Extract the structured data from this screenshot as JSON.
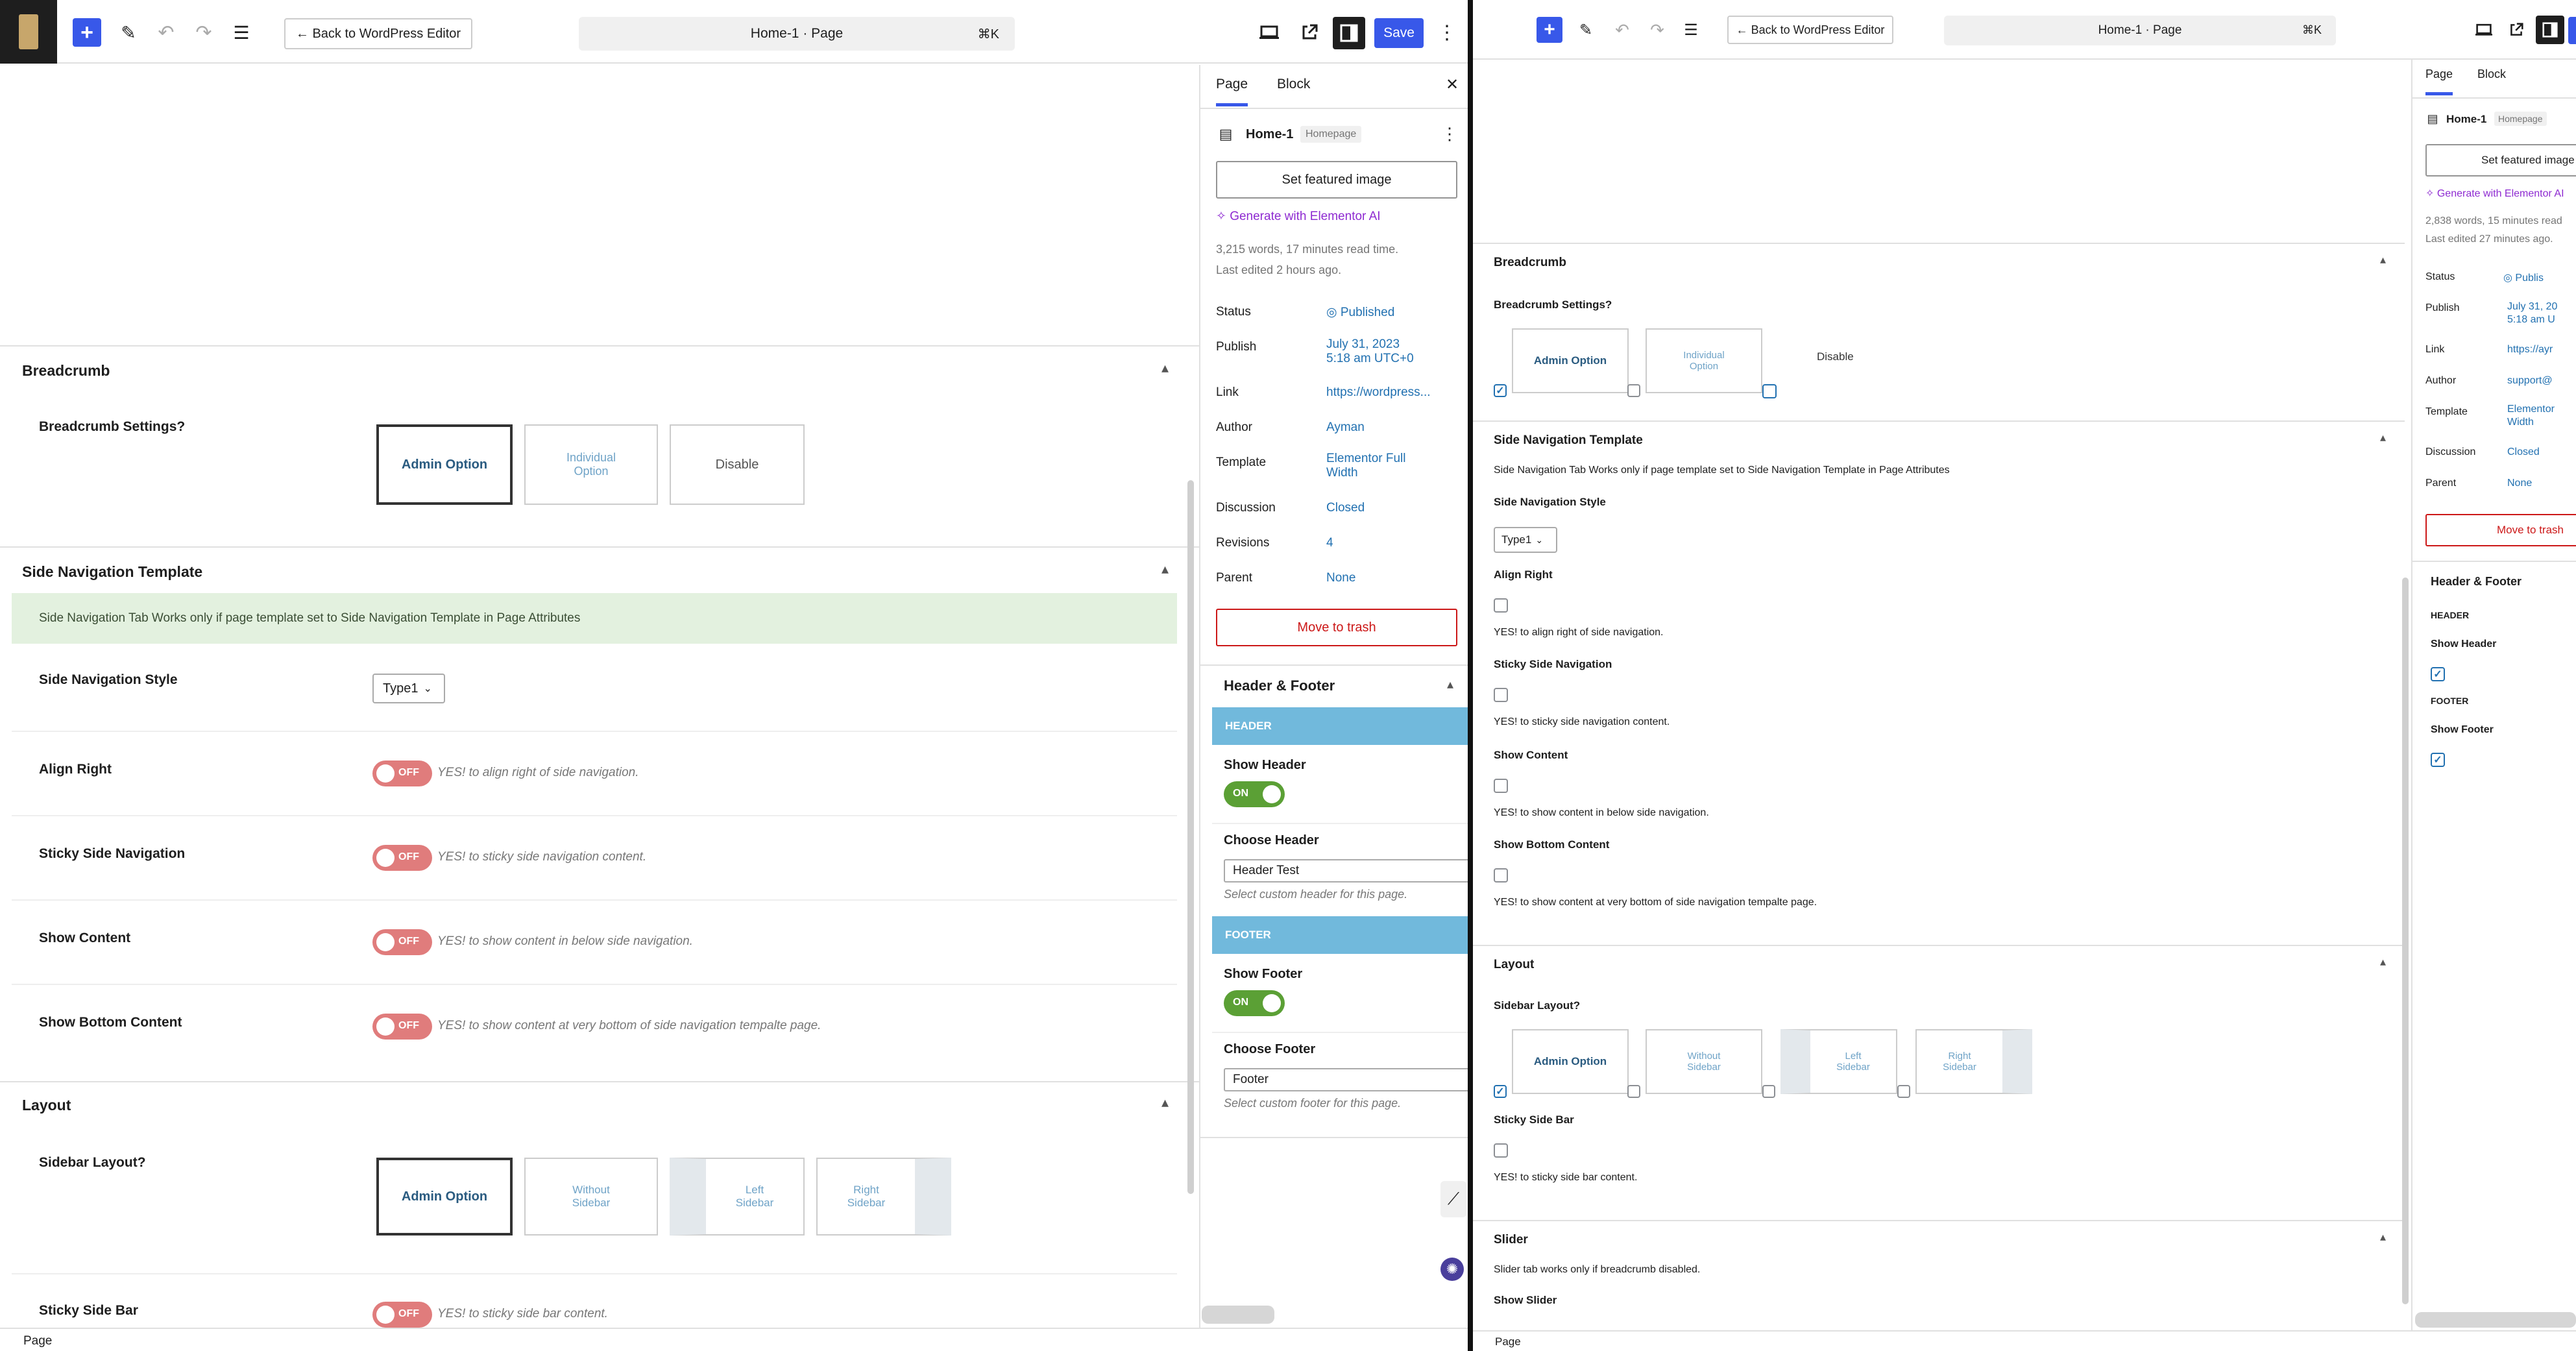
{
  "toolbar": {
    "back": "← Back to WordPress Editor",
    "title": "Home-1 · Page",
    "shortcut": "⌘K",
    "save": "Save",
    "add": "+"
  },
  "sidebar": {
    "tabs": [
      "Page",
      "Block"
    ],
    "page_title": "Home-1",
    "page_badge": "Homepage",
    "featured": "Set featured image",
    "generate": "Generate with Elementor AI",
    "stats_a": "3,215 words, 17 minutes read time.",
    "edited_a": "Last edited 2 hours ago.",
    "stats_b": "2,838 words, 15 minutes read",
    "edited_b": "Last edited 27 minutes ago.",
    "labels": {
      "status": "Status",
      "publish": "Publish",
      "link": "Link",
      "author": "Author",
      "template": "Template",
      "discussion": "Discussion",
      "revisions": "Revisions",
      "parent": "Parent"
    },
    "values_a": {
      "status": "Published",
      "publish1": "July 31, 2023",
      "publish2": "5:18 am UTC+0",
      "link": "https://wordpress...",
      "author": "Ayman",
      "template1": "Elementor Full",
      "template2": "Width",
      "discussion": "Closed",
      "revisions": "4",
      "parent": "None"
    },
    "values_b": {
      "status": "Publis",
      "publish1": "July 31, 20",
      "publish2": "5:18 am U",
      "link": "https://ayr",
      "author": "support@",
      "template1": "Elementor",
      "template2": "Width",
      "discussion": "Closed",
      "parent": "None"
    },
    "trash": "Move to trash",
    "hf": {
      "title": "Header & Footer",
      "header": "HEADER",
      "show_header": "Show Header",
      "on": "ON",
      "choose_header": "Choose Header",
      "header_value": "Header Test",
      "header_hint": "Select custom header for this page.",
      "footer": "FOOTER",
      "show_footer": "Show Footer",
      "choose_footer": "Choose Footer",
      "footer_value": "Footer",
      "footer_hint": "Select custom footer for this page."
    }
  },
  "meta": {
    "breadcrumb": "Breadcrumb",
    "breadcrumb_settings": "Breadcrumb Settings?",
    "opt_admin": "Admin Option",
    "opt_individual": "Individual Option",
    "opt_disable": "Disable",
    "sidenav": "Side Navigation Template",
    "sidenav_note": "Side Navigation Tab Works only if page template set to Side Navigation Template in Page Attributes",
    "sidenav_style": "Side Navigation Style",
    "type1": "Type1",
    "align_right": "Align Right",
    "align_right_hint": "YES! to align right of side navigation.",
    "sticky": "Sticky Side Navigation",
    "sticky_hint": "YES! to sticky side navigation content.",
    "show_content": "Show Content",
    "show_content_hint": "YES! to show content in below side navigation.",
    "show_bottom": "Show Bottom Content",
    "show_bottom_hint": "YES! to show content at very bottom of side navigation tempalte page.",
    "layout": "Layout",
    "sidebar_layout": "Sidebar Layout?",
    "opt_without": "Without Sidebar",
    "opt_left": "Left Sidebar",
    "opt_right": "Right Sidebar",
    "sticky_bar": "Sticky Side Bar",
    "sticky_bar_hint": "YES! to sticky side bar content.",
    "off": "OFF",
    "slider": "Slider",
    "slider_note": "Slider tab works only if breadcrumb disabled.",
    "show_slider": "Show Slider",
    "check": "✓"
  },
  "footer_label": "Page"
}
